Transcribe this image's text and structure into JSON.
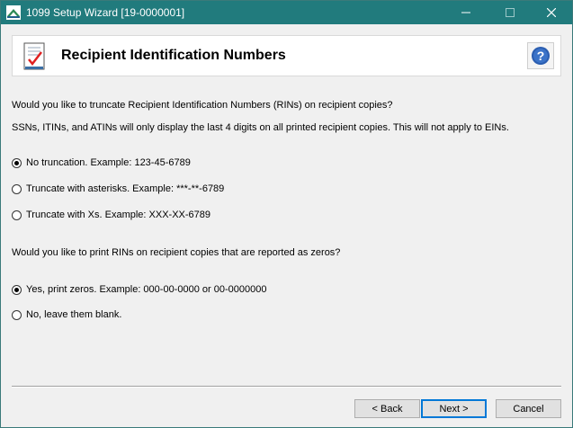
{
  "window": {
    "title": "1099 Setup Wizard [19-0000001]",
    "titlebar_color": "#217b7d"
  },
  "header": {
    "title": "Recipient Identification Numbers",
    "icon": "checklist-icon",
    "help_icon": "help-icon"
  },
  "section1": {
    "question": "Would you like to truncate Recipient Identification Numbers (RINs) on recipient copies?",
    "note": "SSNs, ITINs, and ATINs will only display the last 4 digits on all printed recipient copies. This will not apply to EINs.",
    "options": [
      {
        "label": "No truncation. Example: 123-45-6789",
        "selected": true
      },
      {
        "label": "Truncate with asterisks. Example: ***-**-6789",
        "selected": false
      },
      {
        "label": "Truncate with Xs. Example: XXX-XX-6789",
        "selected": false
      }
    ]
  },
  "section2": {
    "question": "Would you like to print RINs on recipient copies that are reported as zeros?",
    "options": [
      {
        "label": "Yes, print zeros. Example: 000-00-0000 or 00-0000000",
        "selected": true
      },
      {
        "label": "No, leave them blank.",
        "selected": false
      }
    ]
  },
  "buttons": {
    "back": "< Back",
    "next": "Next >",
    "cancel": "Cancel"
  }
}
